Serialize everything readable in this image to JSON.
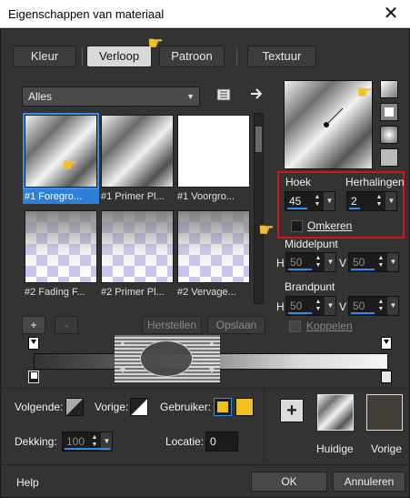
{
  "window": {
    "title": "Eigenschappen van materiaal",
    "close_glyph": "✕"
  },
  "tabs": [
    {
      "label": "Kleur"
    },
    {
      "label": "Verloop"
    },
    {
      "label": "Patroon"
    },
    {
      "label": "Textuur"
    }
  ],
  "category": {
    "selected": "Alles"
  },
  "gradients": [
    {
      "caption": "#1 Foregro..."
    },
    {
      "caption": "#1 Primer Pl..."
    },
    {
      "caption": "#1 Voorgro..."
    },
    {
      "caption": "#2 Fading F..."
    },
    {
      "caption": "#2 Primer Pl..."
    },
    {
      "caption": "#2 Vervage..."
    }
  ],
  "gradient_controls": {
    "angle_label": "Hoek",
    "angle_value": "45",
    "repeats_label": "Herhalingen",
    "repeats_value": "2",
    "invert_label": "Omkeren",
    "invert_checked": false
  },
  "midpoint": {
    "label": "Middelpunt",
    "h_label": "H",
    "h_value": "50",
    "v_label": "V",
    "v_value": "50"
  },
  "focal": {
    "label": "Brandpunt",
    "h_label": "H",
    "h_value": "50",
    "v_label": "V",
    "v_value": "50",
    "link_label": "Koppelen",
    "link_checked": false
  },
  "editor_buttons": {
    "add": "+",
    "remove": "-",
    "reset": "Herstellen",
    "save": "Opslaan"
  },
  "stops": {
    "next_label": "Volgende:",
    "prev_label": "Vorige:",
    "user_label": "Gebruiker:",
    "opacity_label": "Dekking:",
    "opacity_value": "100",
    "location_label": "Locatie:",
    "location_value": "0",
    "user_color": "#f0c020"
  },
  "current": {
    "add_glyph": "+",
    "current_label": "Huidige",
    "previous_label": "Vorige",
    "previous_color": "#433d38"
  },
  "footer": {
    "help": "Help",
    "ok": "OK",
    "cancel": "Annuleren"
  },
  "icons": [
    "collection-icon",
    "arrow-right-icon",
    "pointing-hand-icon",
    "radial-gradient-icon",
    "checkerboard-icon"
  ]
}
